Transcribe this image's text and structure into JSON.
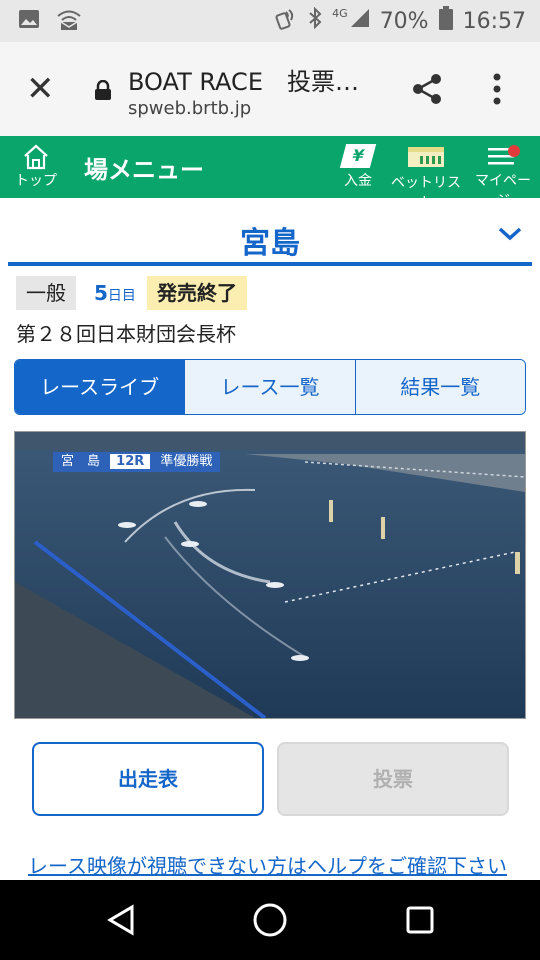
{
  "status": {
    "signal_label": "4G",
    "battery": "70%",
    "time": "16:57"
  },
  "browser": {
    "page_title": "BOAT RACE　投票…",
    "domain": "spweb.brtb.jp"
  },
  "header": {
    "home_label": "トップ",
    "menu_title": "場メニュー",
    "deposit_label": "入金",
    "betlist_label": "ベットリスト",
    "mypage_label": "マイページ",
    "deposit_symbol": "¥"
  },
  "venue": {
    "name": "宮島"
  },
  "race_info": {
    "grade": "一般",
    "day_num": "5",
    "day_unit": "日目",
    "sale_status": "発売終了",
    "race_title": "第２８回日本財団会長杯"
  },
  "tabs": [
    {
      "label": "レースライブ",
      "active": true
    },
    {
      "label": "レース一覧",
      "active": false
    },
    {
      "label": "結果一覧",
      "active": false
    }
  ],
  "video": {
    "overlay_venue": "宮　島",
    "overlay_race": "12R",
    "overlay_type": "準優勝戦"
  },
  "buttons": {
    "entry_table": "出走表",
    "vote": "投票"
  },
  "help_link": "レース映像が視聴できない方はヘルプをご確認下さい",
  "colors": {
    "green": "#0aa56b",
    "blue": "#1566c9",
    "sale_badge": "#fbeeb0"
  }
}
